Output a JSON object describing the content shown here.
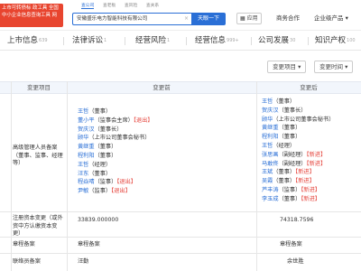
{
  "logo": {
    "text": "上市可转债标 政工具 全国中小企业信息查询工具 网"
  },
  "search_tabs": [
    "查公司",
    "查老板",
    "查风险",
    "查关系"
  ],
  "search": {
    "value": "安徽盛乐电力智能科技有限公司",
    "button": "天眼一下"
  },
  "topbar": {
    "app": "应用",
    "business": "商务合作",
    "service": "企业级产品"
  },
  "nav": [
    {
      "label": "上市信息",
      "count": "639"
    },
    {
      "label": "法律诉讼",
      "count": "1"
    },
    {
      "label": "经营风险",
      "count": "1"
    },
    {
      "label": "经营信息",
      "count": "999+"
    },
    {
      "label": "公司发展",
      "count": "30"
    },
    {
      "label": "知识产权",
      "count": "100"
    }
  ],
  "filters": {
    "change_item": "变更项目",
    "change_time": "变更时间"
  },
  "table": {
    "headers": [
      "变更项目",
      "变更前",
      "变更后"
    ],
    "rows": [
      {
        "item": "高级管理人员备案（董事、监事、经理等）",
        "before": [
          {
            "name": "王哲",
            "role": "（董事）",
            "tag": ""
          },
          {
            "name": "董小平",
            "role": "（监事会主席）",
            "tag": "【退出】"
          },
          {
            "name": "贺庆汉",
            "role": "（董事长）",
            "tag": ""
          },
          {
            "name": "顾华",
            "role": "（上市公司董事会秘书）",
            "tag": ""
          },
          {
            "name": "黄继重",
            "role": "（董事）",
            "tag": ""
          },
          {
            "name": "程利阳",
            "role": "（董事）",
            "tag": ""
          },
          {
            "name": "王哲",
            "role": "（经理）",
            "tag": ""
          },
          {
            "name": "汪东",
            "role": "（董事）",
            "tag": ""
          },
          {
            "name": "程焱晴",
            "role": "（监事）",
            "tag": "【退出】"
          },
          {
            "name": "尹敏",
            "role": "（监事）",
            "tag": "【退出】"
          }
        ],
        "after": [
          {
            "name": "王哲",
            "role": "（董事）",
            "tag": ""
          },
          {
            "name": "贺庆汉",
            "role": "（董事长）",
            "tag": ""
          },
          {
            "name": "顾华",
            "role": "（上市公司董事会秘书）",
            "tag": ""
          },
          {
            "name": "黄继重",
            "role": "（董事）",
            "tag": ""
          },
          {
            "name": "程利阳",
            "role": "（董事）",
            "tag": ""
          },
          {
            "name": "王哲",
            "role": "（经理）",
            "tag": ""
          },
          {
            "name": "张思画",
            "role": "（副经理）",
            "tag": "【新进】"
          },
          {
            "name": "马敢佟",
            "role": "（副经理）",
            "tag": "【新进】"
          },
          {
            "name": "王斌",
            "role": "（董事）",
            "tag": "【新进】"
          },
          {
            "name": "吴霞",
            "role": "（董事）",
            "tag": "【新进】"
          },
          {
            "name": "芦丰涛",
            "role": "（监事）",
            "tag": "【新进】"
          },
          {
            "name": "李玉成",
            "role": "（董事）",
            "tag": "【新进】"
          }
        ]
      },
      {
        "item": "注册资本变更（或外资中方认缴资本变更）",
        "before": "33839.000000",
        "after": "74318.7596"
      },
      {
        "item": "章程备案",
        "before": "章程备案",
        "after": "章程备案"
      },
      {
        "item": "联络员备案",
        "before": "汪勤",
        "after": "余世胜"
      }
    ]
  },
  "colors": {
    "brand": "#2a6fd6",
    "accent_red": "#e5433b",
    "logo_bg": "#e8452f"
  }
}
